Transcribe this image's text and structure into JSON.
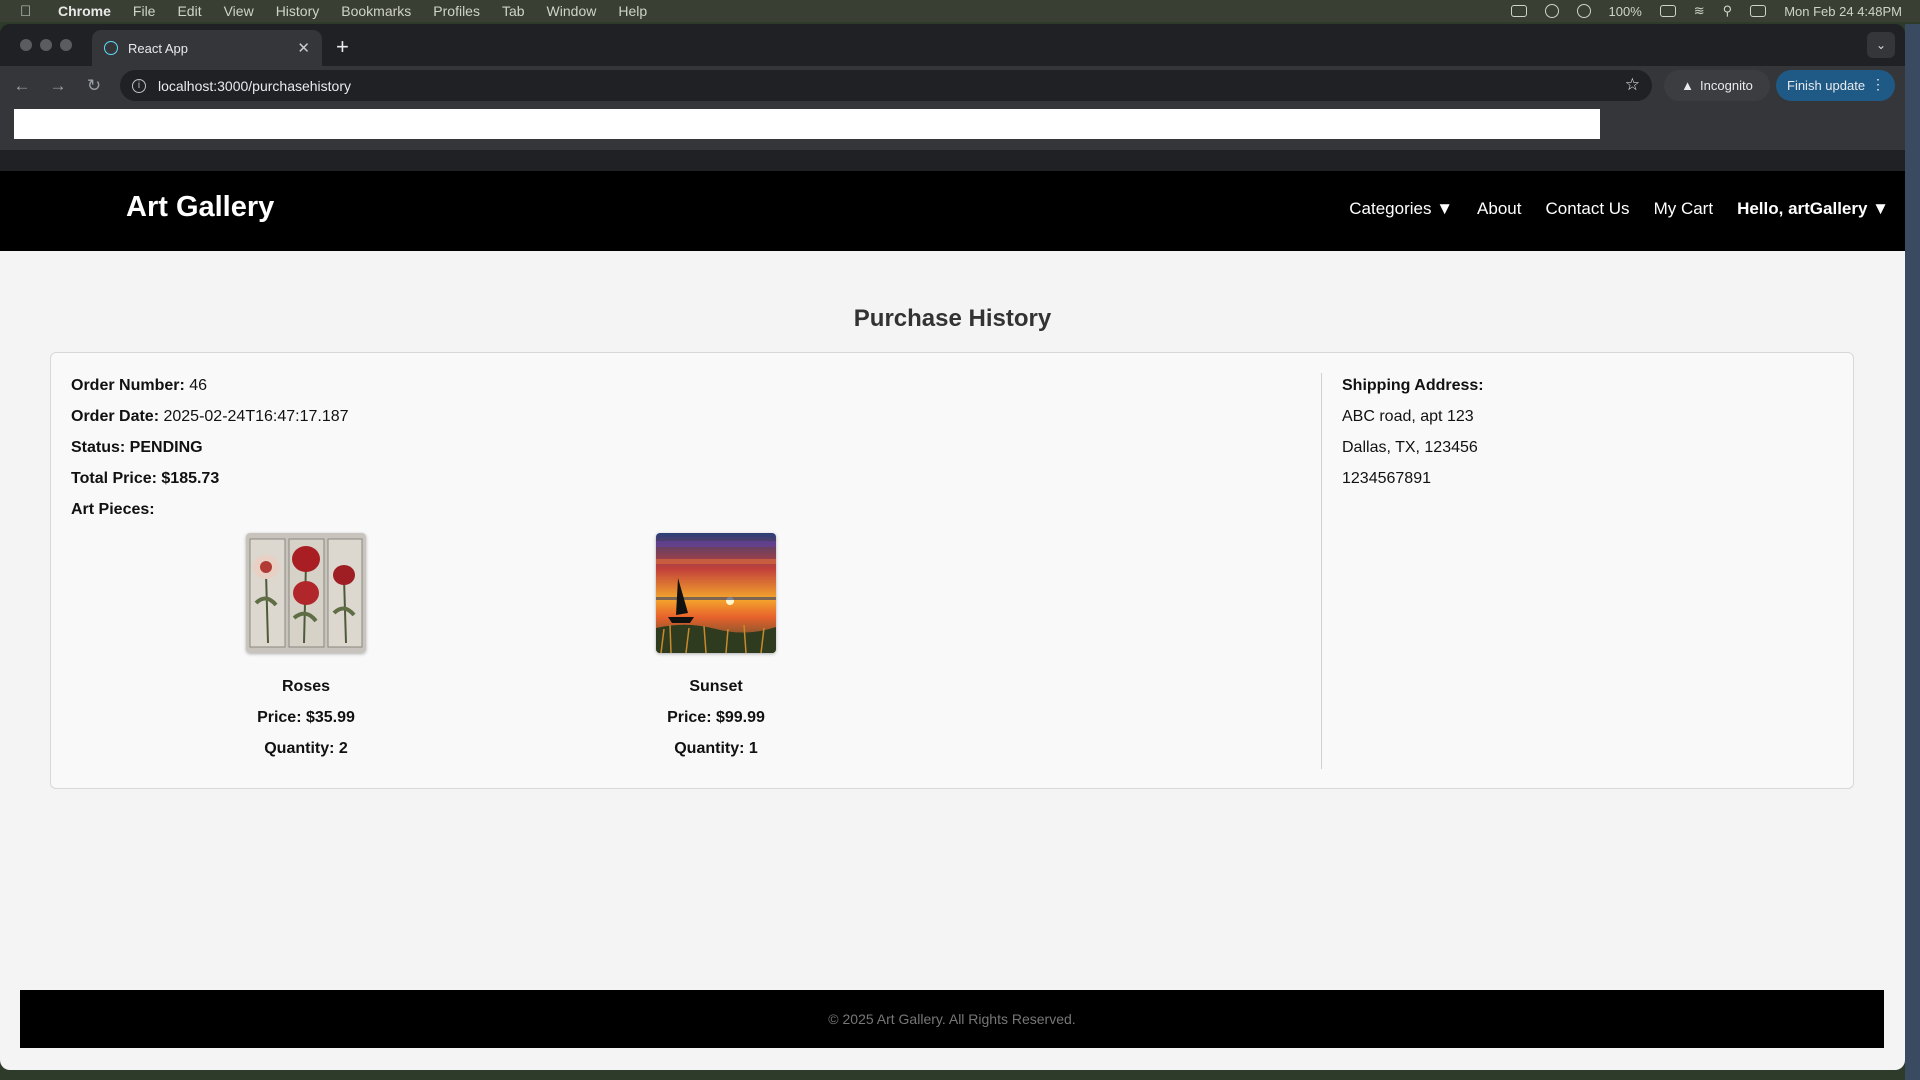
{
  "menubar": {
    "app": "Chrome",
    "items": [
      "File",
      "Edit",
      "View",
      "History",
      "Bookmarks",
      "Profiles",
      "Tab",
      "Window",
      "Help"
    ],
    "battery": "100%",
    "datetime": "Mon Feb 24  4:48PM"
  },
  "browser": {
    "tab_title": "React App",
    "url": "localhost:3000/purchasehistory",
    "incognito_label": "Incognito",
    "update_label": "Finish update"
  },
  "nav": {
    "brand": "Art Gallery",
    "categories": "Categories ▼",
    "about": "About",
    "contact": "Contact Us",
    "cart": "My Cart",
    "user": "Hello, artGallery ▼"
  },
  "page": {
    "heading": "Purchase History"
  },
  "order": {
    "number_label": "Order Number:",
    "number": " 46",
    "date_label": "Order Date:",
    "date": " 2025-02-24T16:47:17.187",
    "status": "Status: PENDING",
    "total": "Total Price: $185.73",
    "pieces_label": "Art Pieces:",
    "pieces": [
      {
        "name": "Roses",
        "price": "Price: $35.99",
        "quantity": "Quantity: 2"
      },
      {
        "name": "Sunset",
        "price": "Price: $99.99",
        "quantity": "Quantity: 1"
      }
    ]
  },
  "shipping": {
    "label": "Shipping Address:",
    "line1": "ABC road, apt 123",
    "line2": "Dallas, TX, 123456",
    "phone": "1234567891"
  },
  "footer": {
    "text": "© 2025 Art Gallery. All Rights Reserved."
  }
}
